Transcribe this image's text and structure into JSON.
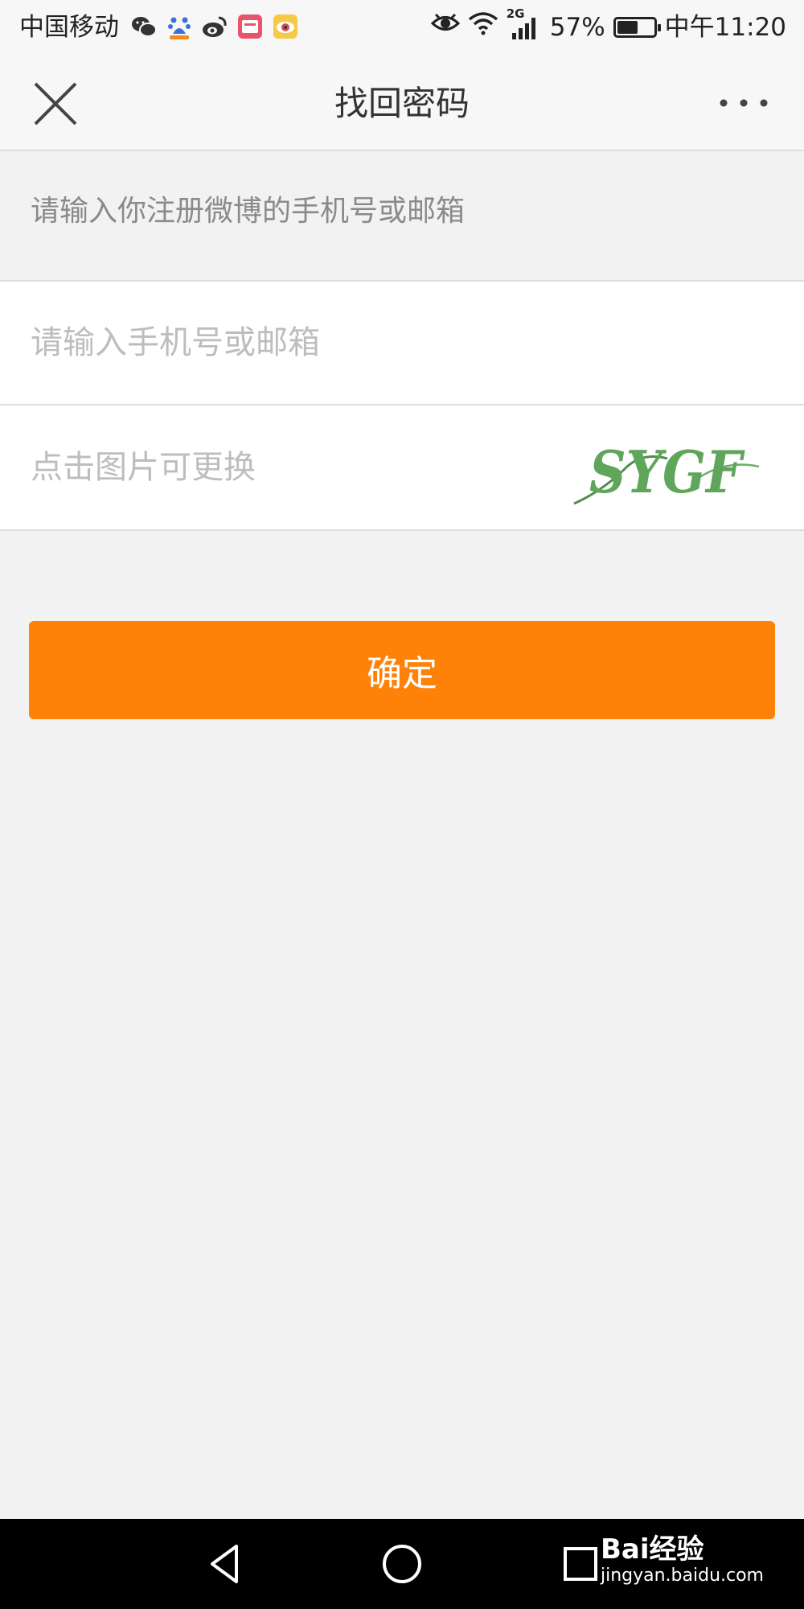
{
  "status_bar": {
    "carrier": "中国移动",
    "app_icons": [
      "wechat-icon",
      "baidu-icon",
      "weibo-icon",
      "shop-icon",
      "eye-app-icon"
    ],
    "network": "2G",
    "battery_percent": "57%",
    "battery_level": 0.57,
    "time": "中午11:20"
  },
  "nav": {
    "title": "找回密码"
  },
  "hint": "请输入你注册微博的手机号或邮箱",
  "form": {
    "account_placeholder": "请输入手机号或邮箱",
    "account_value": "",
    "captcha_placeholder": "点击图片可更换",
    "captcha_value": "",
    "captcha_image_text": "SYGF"
  },
  "confirm_label": "确定",
  "watermark": {
    "brand": "Bai经验",
    "url": "jingyan.baidu.com"
  },
  "colors": {
    "accent": "#ff8208",
    "background": "#f2f2f2",
    "captcha_green": "#5fa55a"
  }
}
